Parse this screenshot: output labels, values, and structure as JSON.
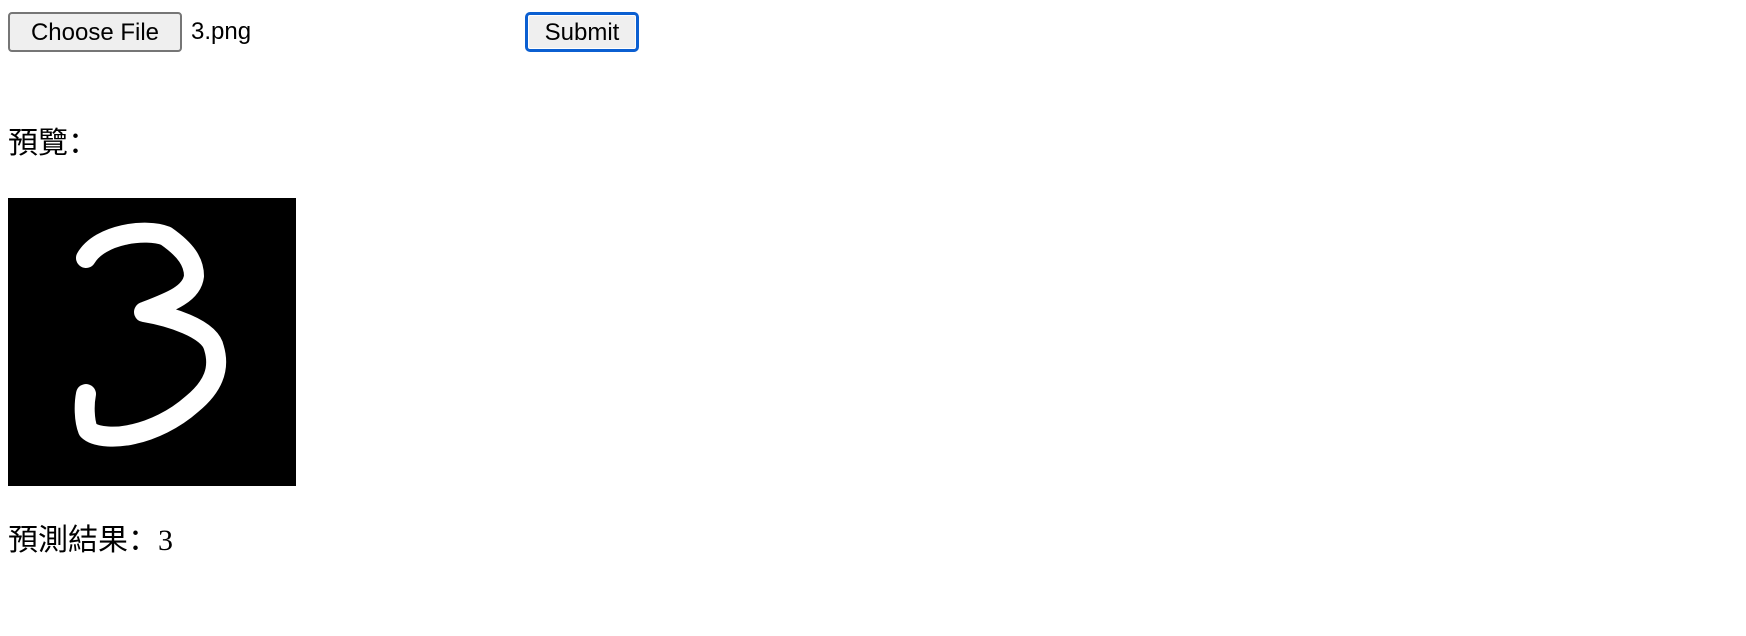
{
  "upload_form": {
    "choose_file_label": "Choose File",
    "file_name": "3.png",
    "submit_label": "Submit"
  },
  "preview": {
    "label": "預覽：",
    "image_content": "3"
  },
  "result": {
    "label": "預測結果：",
    "value": "3"
  },
  "colors": {
    "submit_focus_border": "#0b5fd1",
    "button_background": "#efefef",
    "preview_background": "#000000",
    "digit_stroke": "#ffffff"
  }
}
